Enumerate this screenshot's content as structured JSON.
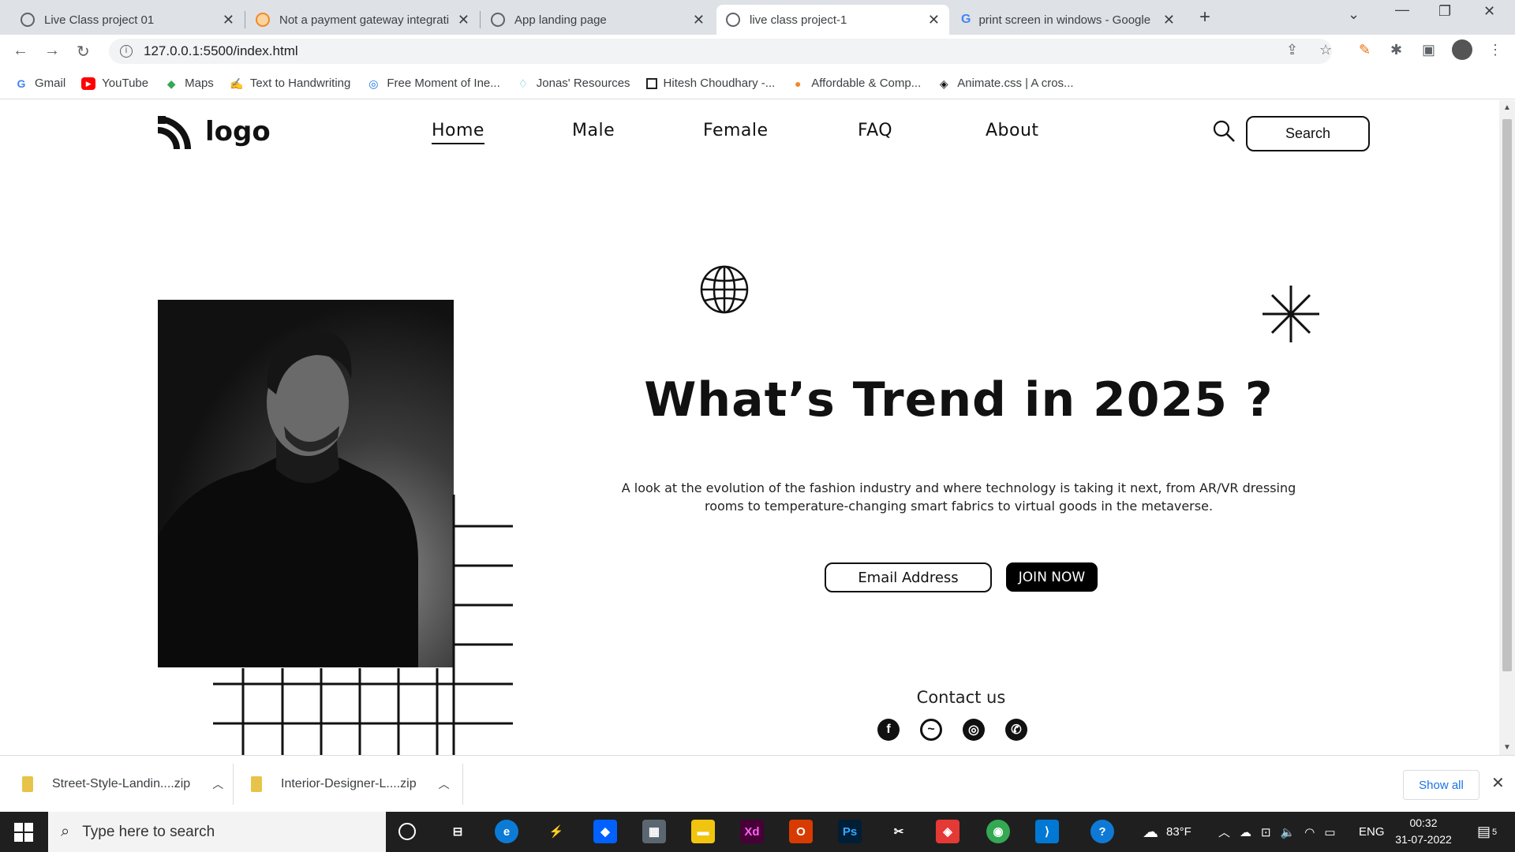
{
  "browser": {
    "tabs": [
      {
        "title": "Live Class project 01",
        "icon": "globe-icon",
        "active": false
      },
      {
        "title": "Not a payment gateway integrati",
        "icon": "site-icon",
        "active": false
      },
      {
        "title": "App landing page",
        "icon": "globe-icon",
        "active": false
      },
      {
        "title": "live class project-1",
        "icon": "globe-icon",
        "active": true
      },
      {
        "title": "print screen in windows - Google",
        "icon": "google-icon",
        "active": false
      }
    ],
    "url": "127.0.0.1:5500/index.html",
    "bookmarks": [
      {
        "label": "Gmail",
        "icon": "google-icon"
      },
      {
        "label": "YouTube",
        "icon": "youtube-icon"
      },
      {
        "label": "Maps",
        "icon": "maps-icon"
      },
      {
        "label": "Text to Handwriting",
        "icon": "pen-icon"
      },
      {
        "label": "Free Moment of Ine...",
        "icon": "site-icon"
      },
      {
        "label": "Jonas' Resources",
        "icon": "diamond-icon"
      },
      {
        "label": "Hitesh Choudhary -...",
        "icon": "square-icon"
      },
      {
        "label": "Affordable & Comp...",
        "icon": "site-icon"
      },
      {
        "label": "Animate.css | A cros...",
        "icon": "animate-icon"
      }
    ]
  },
  "site": {
    "logo_text": "logo",
    "nav": [
      "Home",
      "Male",
      "Female",
      "FAQ",
      "About"
    ],
    "search_label": "Search",
    "headline": "What’s Trend in 2025 ?",
    "description": "A look at the evolution of the fashion industry and where technology is taking it next, from AR/VR dressing rooms to temperature-changing smart fabrics to virtual goods in the metaverse.",
    "email_placeholder": "Email Address",
    "join_label": "JOIN NOW",
    "contact_label": "Contact us",
    "socials": [
      "facebook-icon",
      "messenger-icon",
      "instagram-icon",
      "whatsapp-icon"
    ]
  },
  "downloads": {
    "files": [
      "Street-Style-Landin....zip",
      "Interior-Designer-L....zip"
    ],
    "show_all": "Show all"
  },
  "taskbar": {
    "search_placeholder": "Type here to search",
    "weather": "83°F",
    "language": "ENG",
    "time": "00:32",
    "date": "31-07-2022",
    "notifications": "5"
  },
  "colors": {
    "accent": "#000000",
    "tab_bar": "#dee1e6",
    "link": "#1a73e8"
  }
}
